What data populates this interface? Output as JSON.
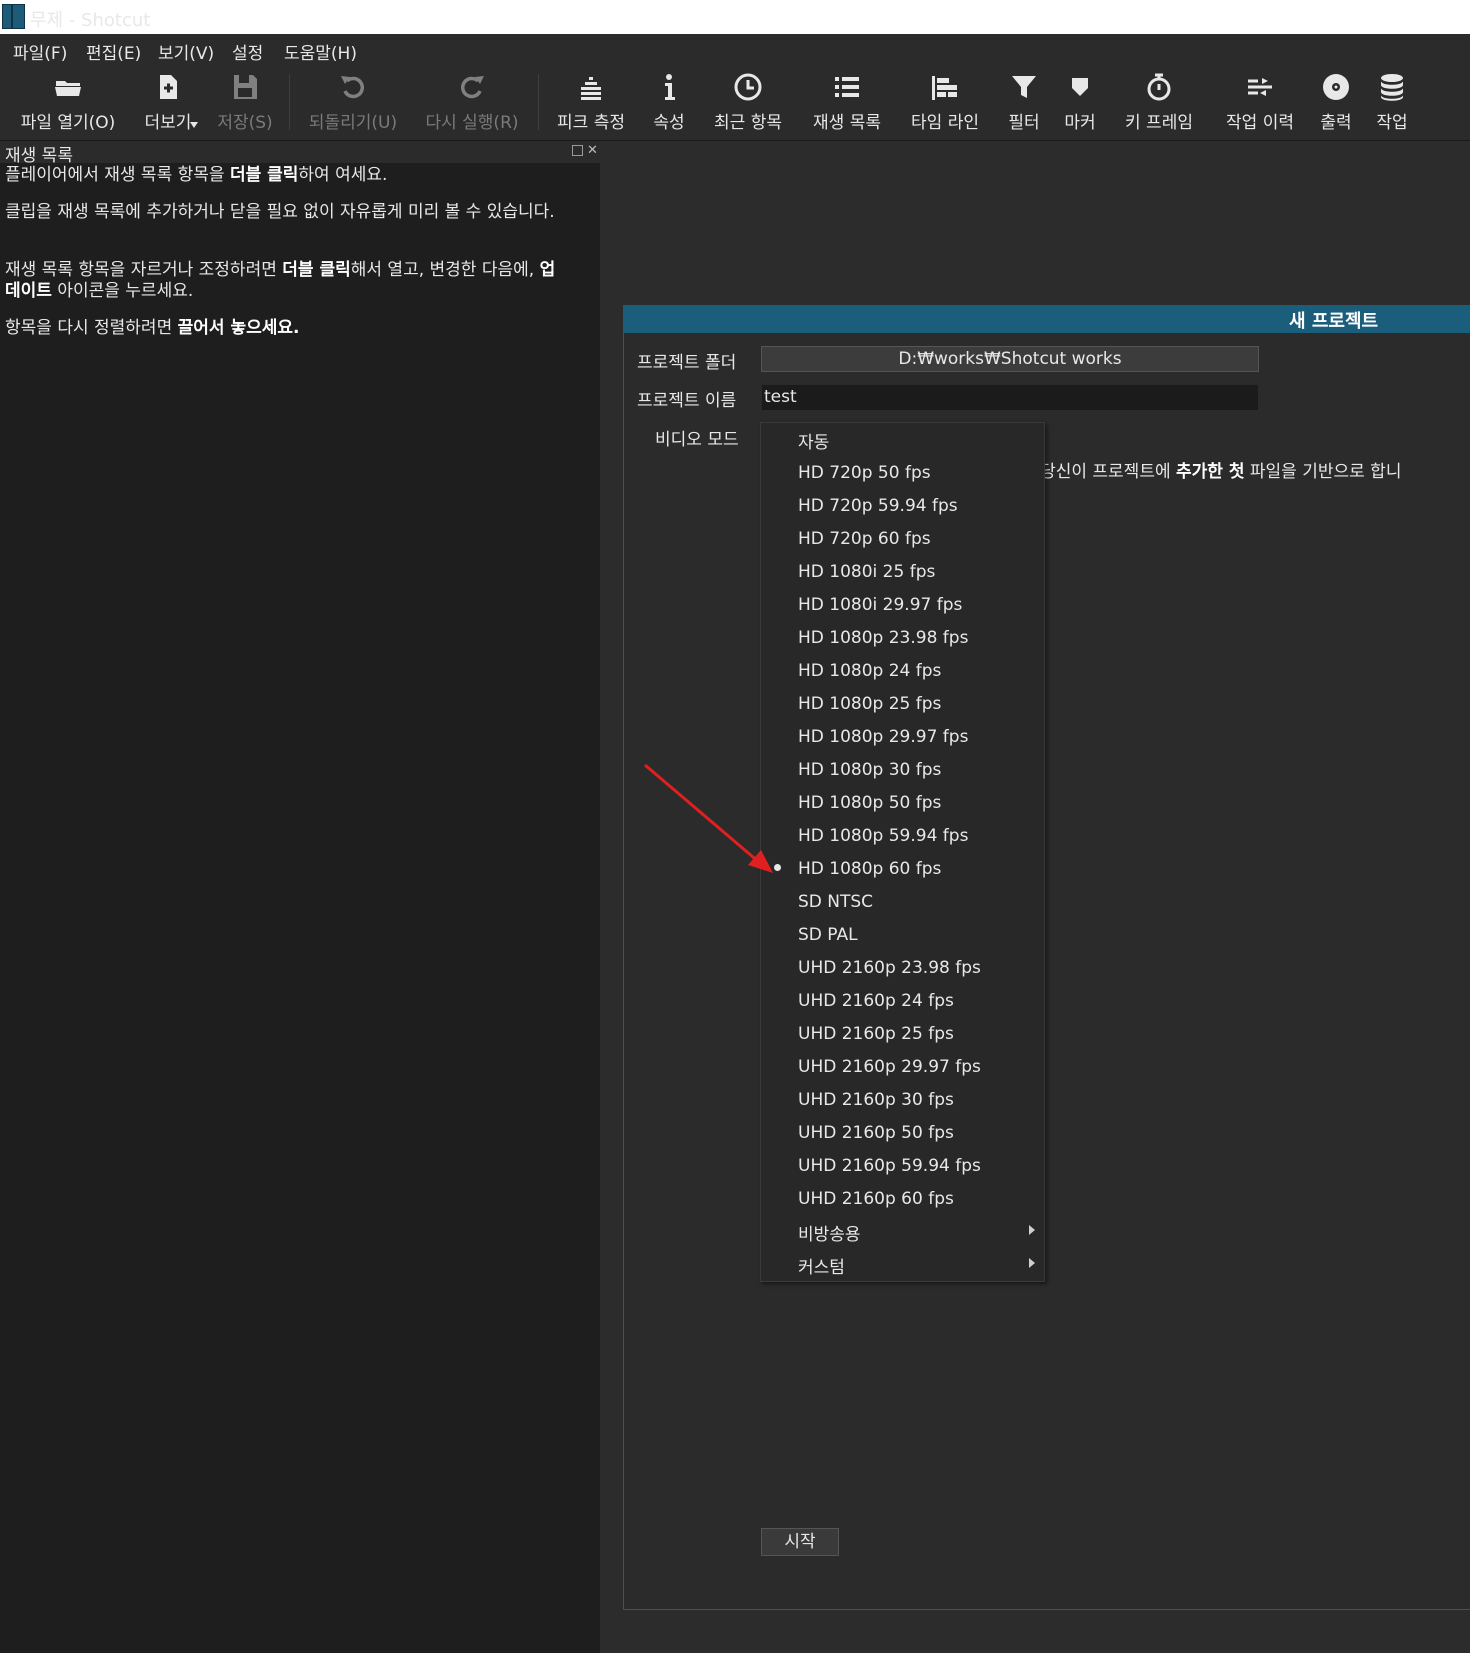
{
  "window": {
    "title": "무제 - Shotcut"
  },
  "menubar": [
    "파일(F)",
    "편집(E)",
    "보기(V)",
    "설정",
    "도움말(H)"
  ],
  "toolbar": {
    "items": [
      {
        "label": "파일 열기(O)",
        "icon": "folder-open-icon",
        "enabled": true
      },
      {
        "label": "더보기",
        "icon": "file-add-icon",
        "enabled": true
      },
      {
        "label": "저장(S)",
        "icon": "save-icon",
        "enabled": false
      },
      {
        "label": "되돌리기(U)",
        "icon": "undo-icon",
        "enabled": false
      },
      {
        "label": "다시 실행(R)",
        "icon": "redo-icon",
        "enabled": false
      },
      {
        "label": "피크 측정",
        "icon": "peak-meter-icon",
        "enabled": true
      },
      {
        "label": "속성",
        "icon": "info-icon",
        "enabled": true
      },
      {
        "label": "최근 항목",
        "icon": "clock-icon",
        "enabled": true
      },
      {
        "label": "재생 목록",
        "icon": "list-icon",
        "enabled": true
      },
      {
        "label": "타임 라인",
        "icon": "timeline-icon",
        "enabled": true
      },
      {
        "label": "필터",
        "icon": "filter-icon",
        "enabled": true
      },
      {
        "label": "마커",
        "icon": "marker-icon",
        "enabled": true
      },
      {
        "label": "키 프레임",
        "icon": "stopwatch-icon",
        "enabled": true
      },
      {
        "label": "작업 이력",
        "icon": "history-icon",
        "enabled": true
      },
      {
        "label": "출력",
        "icon": "disc-icon",
        "enabled": true
      },
      {
        "label": "작업",
        "icon": "jobs-stack-icon",
        "enabled": true
      }
    ]
  },
  "playlist": {
    "title": "재생 목록",
    "para1": {
      "a": "플레이어에서 재생 목록 항목을 ",
      "b": "더블 클릭",
      "c": "하여 여세요."
    },
    "para2": {
      "a": "클립을 재생 목록에 추가하거나 닫을 필요 없이 자유롭게 미리 볼 수 있습니다."
    },
    "para3": {
      "a": "재생 목록 항목을 자르거나 조정하려면 ",
      "b": "더블 클릭",
      "c": "해서 열고, 변경한 다음에, ",
      "d": "업데이트",
      "e": " 아이콘을 누르세요."
    },
    "para4": {
      "a": "항목을 다시 정렬하려면 ",
      "b": "끌어서 놓으세요."
    }
  },
  "new_project": {
    "title": "새 프로젝트",
    "folder_label": "프로젝트 폴더",
    "folder_value": "D:₩works₩Shotcut works",
    "name_label": "프로젝트 이름",
    "name_value": "test",
    "video_mode_label": "비디오 모드",
    "auto_description": {
      "a": "t 당신이 프로젝트에 ",
      "b": "추가한 첫",
      "c": " 파일을 기반으로 합니"
    },
    "start_button": "시작"
  },
  "video_mode_menu": {
    "selected": "HD 1080p 60 fps",
    "items": [
      "자동",
      "HD 720p 50 fps",
      "HD 720p 59.94 fps",
      "HD 720p 60 fps",
      "HD 1080i 25 fps",
      "HD 1080i 29.97 fps",
      "HD 1080p 23.98 fps",
      "HD 1080p 24 fps",
      "HD 1080p 25 fps",
      "HD 1080p 29.97 fps",
      "HD 1080p 30 fps",
      "HD 1080p 50 fps",
      "HD 1080p 59.94 fps",
      "HD 1080p 60 fps",
      "SD NTSC",
      "SD PAL",
      "UHD 2160p 23.98 fps",
      "UHD 2160p 24 fps",
      "UHD 2160p 25 fps",
      "UHD 2160p 29.97 fps",
      "UHD 2160p 30 fps",
      "UHD 2160p 50 fps",
      "UHD 2160p 59.94 fps",
      "UHD 2160p 60 fps"
    ],
    "submenus": [
      "비방송용",
      "커스텀"
    ]
  },
  "colors": {
    "accent": "#1b5e7b",
    "annotation_arrow": "#e02020",
    "background": "#2c2c2c"
  }
}
